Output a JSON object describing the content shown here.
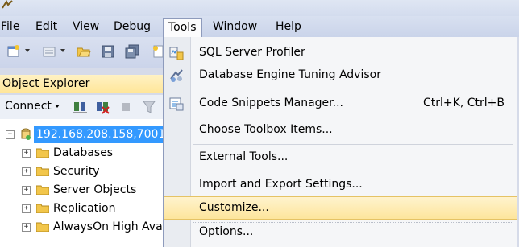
{
  "menubar": {
    "items": [
      {
        "label": "File"
      },
      {
        "label": "Edit"
      },
      {
        "label": "View"
      },
      {
        "label": "Debug"
      },
      {
        "label": "Tools",
        "open": true
      },
      {
        "label": "Window"
      },
      {
        "label": "Help"
      }
    ]
  },
  "object_explorer": {
    "title": "Object Explorer",
    "connect_label": "Connect",
    "server": "192.168.208.158,7001",
    "folders": [
      {
        "label": "Databases"
      },
      {
        "label": "Security"
      },
      {
        "label": "Server Objects"
      },
      {
        "label": "Replication"
      },
      {
        "label": "AlwaysOn High Ava"
      }
    ]
  },
  "tools_menu": {
    "items": [
      {
        "label": "SQL Server Profiler",
        "icon": "profiler-icon"
      },
      {
        "label": "Database Engine Tuning Advisor",
        "icon": "tuning-advisor-icon"
      },
      {
        "label": "Code Snippets Manager...",
        "shortcut": "Ctrl+K, Ctrl+B",
        "icon": "code-snippets-icon"
      },
      {
        "label": "Choose Toolbox Items..."
      },
      {
        "label": "External Tools..."
      },
      {
        "label": "Import and Export Settings..."
      },
      {
        "label": "Customize...",
        "highlighted": true
      },
      {
        "label": "Options..."
      }
    ]
  },
  "colors": {
    "accent_highlight": "#fde59c",
    "selection": "#3399ff",
    "menubar": "#d3dcee"
  }
}
